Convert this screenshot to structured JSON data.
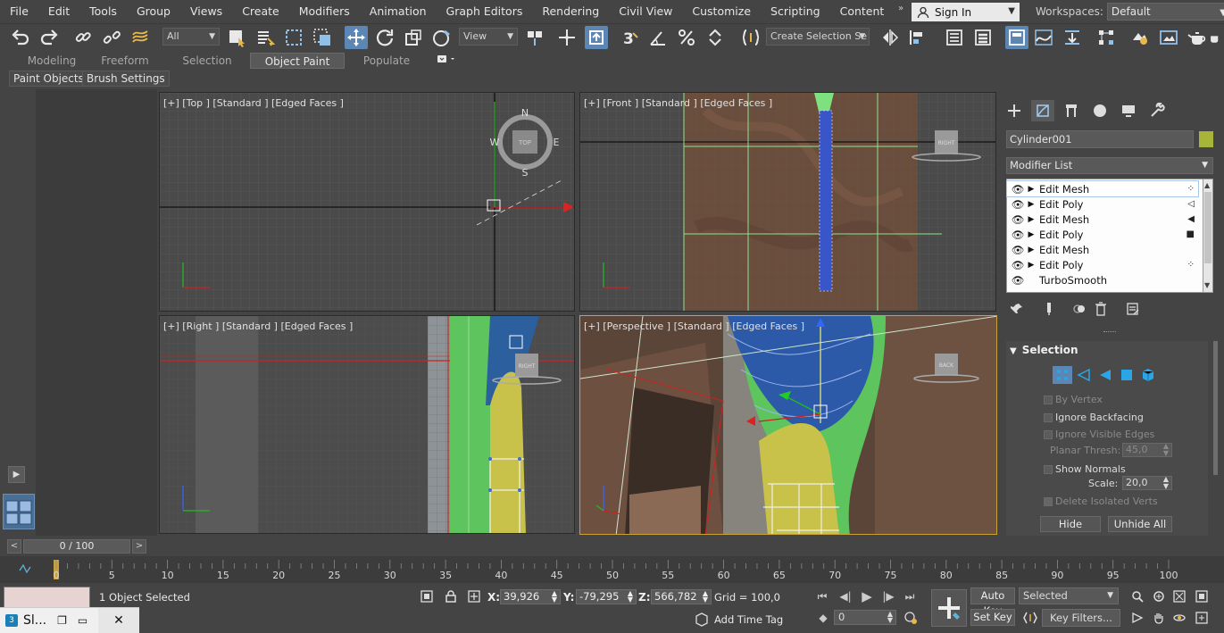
{
  "menu": [
    "File",
    "Edit",
    "Tools",
    "Group",
    "Views",
    "Create",
    "Modifiers",
    "Animation",
    "Graph Editors",
    "Rendering",
    "Civil View",
    "Customize",
    "Scripting",
    "Content"
  ],
  "menu_expander": "»",
  "signin": {
    "label": "Sign In"
  },
  "workspaces": {
    "label": "Workspaces:",
    "value": "Default"
  },
  "toolbar": {
    "filter": "All",
    "ref_coord": "View",
    "selection_set": "Create Selection Se",
    "snap_3": "3"
  },
  "ribbon": {
    "tabs": [
      "Modeling",
      "Freeform",
      "Selection",
      "Object Paint",
      "Populate"
    ],
    "active": "Object Paint",
    "subtabs": [
      "Paint Objects",
      "Brush Settings"
    ]
  },
  "viewports": {
    "top": "[+] [Top ] [Standard ] [Edged Faces ]",
    "front": "[+] [Front ] [Standard ] [Edged Faces ]",
    "right": "[+] [Right ] [Standard ] [Edged Faces ]",
    "perspective": "[+] [Perspective ] [Standard ] [Edged Faces ]",
    "compass": {
      "n": "N",
      "s": "S",
      "e": "E",
      "w": "W",
      "cube": "TOP"
    },
    "cube_right": "RIGHT",
    "cube_back": "BACK"
  },
  "command_panel": {
    "object_name": "Cylinder001",
    "object_color": "#a7b43a",
    "modifier_list": "Modifier List",
    "stack": [
      {
        "name": "Edit Mesh",
        "sub": "⁘"
      },
      {
        "name": "Edit Poly",
        "sub": "◁"
      },
      {
        "name": "Edit Mesh",
        "sub": "◀"
      },
      {
        "name": "Edit Poly",
        "sub": "■"
      },
      {
        "name": "Edit Mesh",
        "sub": ""
      },
      {
        "name": "Edit Poly",
        "sub": "⁘"
      },
      {
        "name": "TurboSmooth",
        "sub": ""
      }
    ],
    "rollout": {
      "title": "Selection",
      "by_vertex": "By Vertex",
      "ignore_backfacing": "Ignore Backfacing",
      "ignore_visible_edges": "Ignore Visible Edges",
      "planar_thresh_label": "Planar Thresh:",
      "planar_thresh": "45,0",
      "show_normals": "Show Normals",
      "scale_label": "Scale:",
      "scale": "20,0",
      "delete_isolated": "Delete Isolated Verts",
      "hide": "Hide",
      "unhide_all": "Unhide All"
    }
  },
  "timeslider": {
    "value": "0 / 100",
    "prev": "<",
    "next": ">"
  },
  "trackbar": {
    "ticks": [
      "0",
      "5",
      "10",
      "15",
      "20",
      "25",
      "30",
      "35",
      "40",
      "45",
      "50",
      "55",
      "60",
      "65",
      "70",
      "75",
      "80",
      "85",
      "90",
      "95",
      "100"
    ]
  },
  "status": {
    "message": "1 Object Selected",
    "x_label": "X:",
    "x": "39,926",
    "y_label": "Y:",
    "y": "-79,295",
    "z_label": "Z:",
    "z": "566,782",
    "grid": "Grid = 100,0",
    "add_time_tag": "Add Time Tag",
    "frame": "0",
    "auto_key": "Auto Key",
    "set_key": "Set Key",
    "selected": "Selected",
    "key_filters": "Key Filters..."
  },
  "taskbar": {
    "app": "Sl...",
    "logo": "3"
  }
}
